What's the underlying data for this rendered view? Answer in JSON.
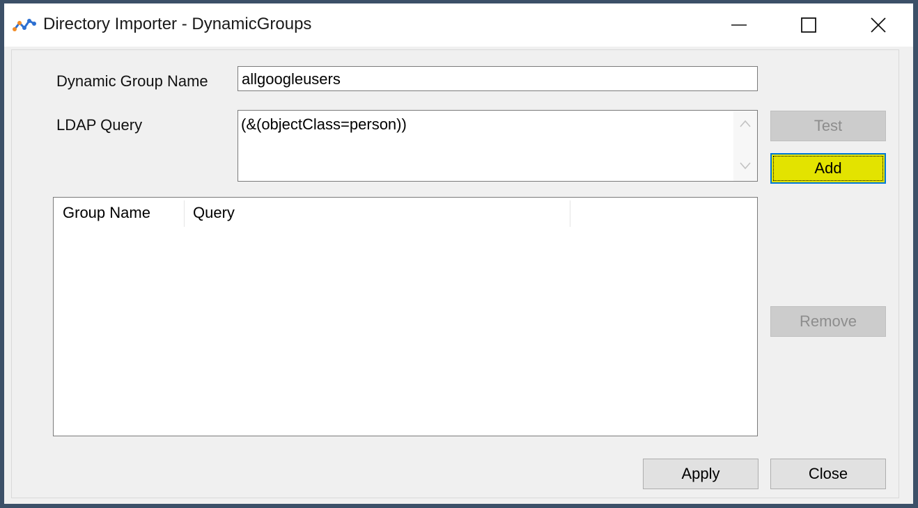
{
  "window": {
    "title": "Directory Importer - DynamicGroups",
    "app_icon": "directory-importer-logo",
    "controls": {
      "minimize": "minimize-icon",
      "maximize": "maximize-icon",
      "close": "close-icon"
    }
  },
  "form": {
    "group_name_label": "Dynamic Group Name",
    "group_name_value": "allgoogleusers",
    "ldap_label": "LDAP Query",
    "ldap_value": "(&(objectClass=person))"
  },
  "buttons": {
    "test": "Test",
    "add": "Add",
    "remove": "Remove",
    "apply": "Apply",
    "close": "Close"
  },
  "list": {
    "columns": [
      "Group Name",
      "Query",
      ""
    ],
    "rows": []
  },
  "colors": {
    "add_button_bg": "#e3e300",
    "focus_border": "#0078d7",
    "outer_frame": "#3c5068"
  }
}
